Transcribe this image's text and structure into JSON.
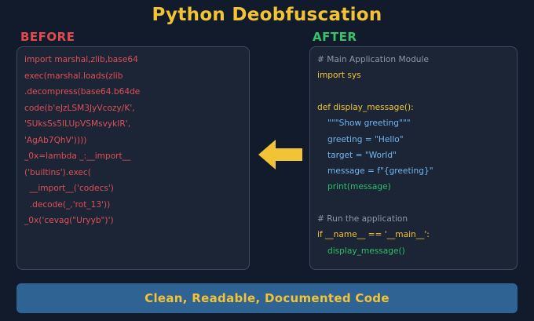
{
  "title": "Python Deobfuscation",
  "before": {
    "label": "BEFORE",
    "lines": [
      "import marshal,zlib,base64",
      "exec(marshal.loads(zlib",
      ".decompress(base64.b64de",
      "code(b'eJzLSM3JyVcozy/K',",
      "'SUksSs5ILUpVSMsvykIR',",
      "'AgAb7QhV'))))",
      "_0x=lambda _:__import__",
      "('builtins').exec(",
      "  __import__('codecs')",
      "  .decode(_,'rot_13'))",
      "_0x('cevag(\"Uryyb\")')"
    ]
  },
  "after": {
    "label": "AFTER",
    "lines": [
      {
        "text": "# Main Application Module",
        "style": "comment",
        "indent": 0
      },
      {
        "text": "import sys",
        "style": "yellow",
        "indent": 0
      },
      {
        "text": "",
        "style": "yellow",
        "indent": 0
      },
      {
        "text": "def display_message():",
        "style": "yellow",
        "indent": 0
      },
      {
        "text": "\"\"\"Show greeting\"\"\"",
        "style": "blue",
        "indent": 1
      },
      {
        "text": "greeting = \"Hello\"",
        "style": "blue",
        "indent": 1
      },
      {
        "text": "target = \"World\"",
        "style": "blue",
        "indent": 1
      },
      {
        "text": "message = f\"{greeting}\"",
        "style": "blue",
        "indent": 1
      },
      {
        "text": "print(message)",
        "style": "green",
        "indent": 1
      },
      {
        "text": "",
        "style": "blue",
        "indent": 0
      },
      {
        "text": "# Run the application",
        "style": "comment",
        "indent": 0
      },
      {
        "text": "if __name__ == '__main__':",
        "style": "yellow",
        "indent": 0
      },
      {
        "text": "display_message()",
        "style": "green",
        "indent": 1
      }
    ]
  },
  "arrow_color": "#f3c336",
  "banner": "Clean, Readable, Documented Code"
}
